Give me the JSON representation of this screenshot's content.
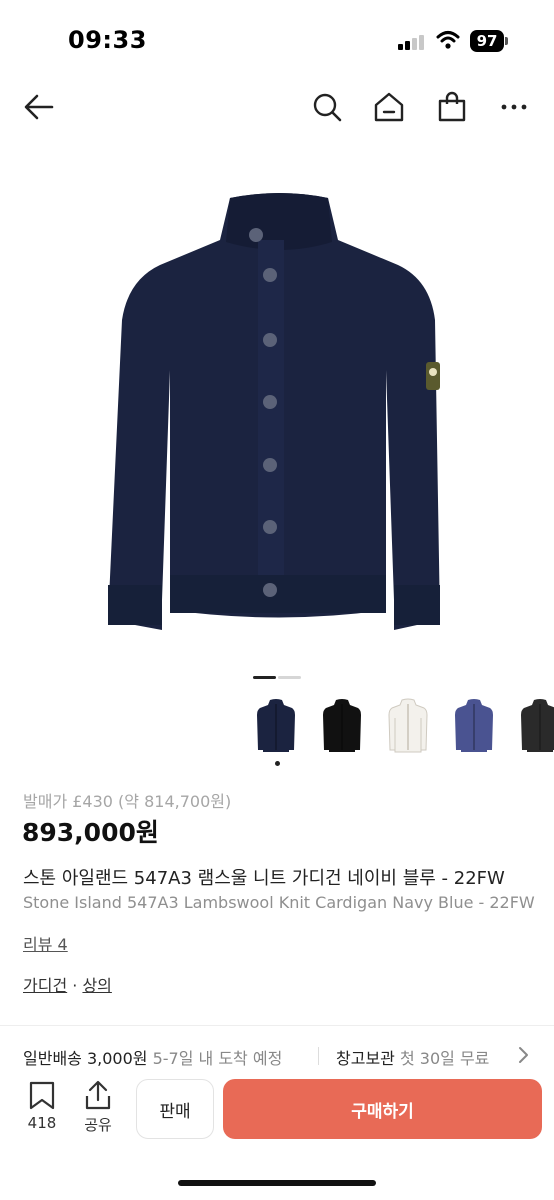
{
  "status_bar": {
    "time": "09:33",
    "battery": "97"
  },
  "nav": {
    "back_icon": "arrow-left-icon",
    "search_icon": "search-icon",
    "home_icon": "home-icon",
    "bag_icon": "shopping-bag-icon",
    "more_icon": "more-icon"
  },
  "gallery": {
    "pages": 2,
    "current_page": 1,
    "thumbnail_colors": [
      "#1b2340",
      "#111111",
      "#f3f1ec",
      "#4a5391",
      "#2a2a2a"
    ],
    "selected_thumbnail": 1
  },
  "product": {
    "release_price": "발매가 £430 (약 814,700원)",
    "price": "893,000원",
    "title_ko": "스톤 아일랜드 547A3 램스울 니트 가디건 네이비 블루 - 22FW",
    "title_en": "Stone Island 547A3 Lambswool Knit Cardigan Navy Blue - 22FW",
    "review": "리뷰 4",
    "category_1": "가디건",
    "category_sep": " · ",
    "category_2": "상의"
  },
  "shipping": {
    "label": "일반배송 3,000원",
    "eta": "5-7일 내 도착 예정",
    "storage_label": "창고보관",
    "storage_note": "첫 30일 무료"
  },
  "bottom": {
    "bookmark_count": "418",
    "share_label": "공유",
    "sell_label": "판매",
    "buy_label": "구매하기"
  },
  "colors": {
    "buy_button": "#e86a56",
    "product_navy": "#1b2340"
  }
}
